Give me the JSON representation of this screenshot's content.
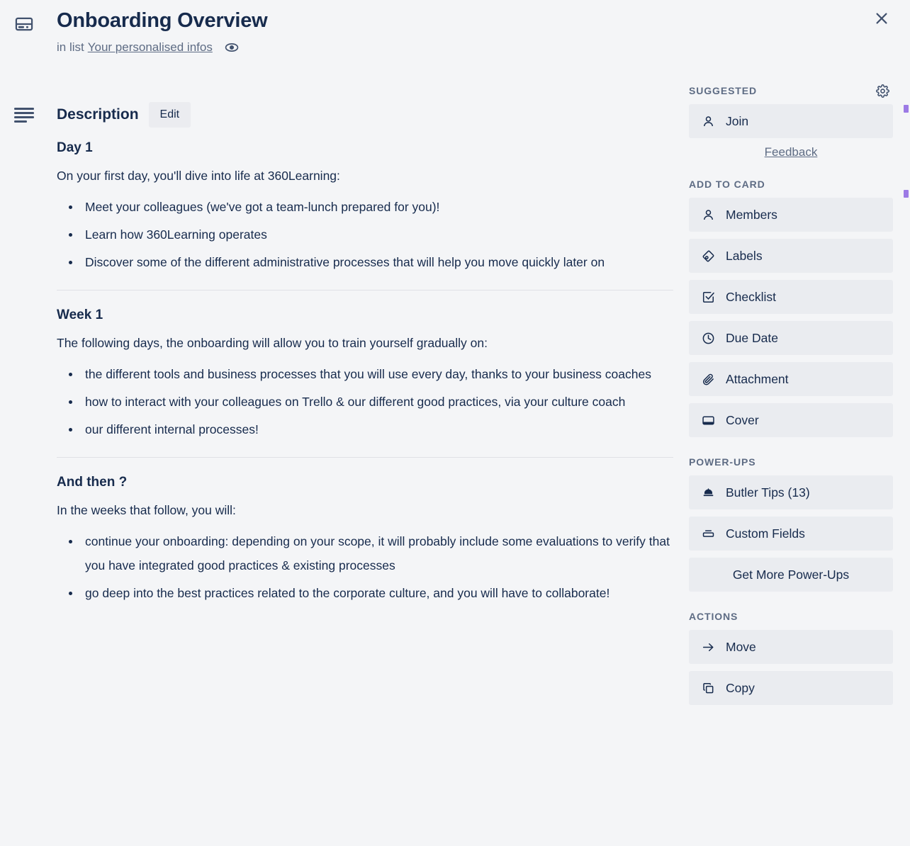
{
  "header": {
    "icon": "card-template-icon",
    "title": "Onboarding Overview",
    "in_list_prefix": "in list",
    "list_name": "Your personalised infos",
    "watch_icon": "eye-icon",
    "close_label": "✕"
  },
  "description": {
    "icon": "description-lines-icon",
    "heading": "Description",
    "edit_label": "Edit",
    "sections": [
      {
        "title": "Day 1",
        "intro": "On your first day, you'll dive into life at 360Learning:",
        "items": [
          "Meet your colleagues (we've got a team-lunch prepared for you)!",
          "Learn how 360Learning operates",
          "Discover some of the different administrative processes that will help you move quickly later on"
        ]
      },
      {
        "title": "Week 1",
        "intro": "The following days, the onboarding will allow you to train yourself gradually on:",
        "items": [
          "the different tools and business processes that you will use every day, thanks to your business coaches",
          "how to interact with your colleagues on Trello & our different good practices, via your culture coach",
          "our different internal processes!"
        ]
      },
      {
        "title": "And then ?",
        "intro": "In the weeks that follow, you will:",
        "items": [
          "continue your onboarding: depending on your scope, it will probably include some evaluations to verify that you have integrated good practices & existing processes",
          "go deep into the best practices related to the corporate culture, and you will have to collaborate!"
        ]
      }
    ]
  },
  "sidebar": {
    "suggested": {
      "heading": "SUGGESTED",
      "gear_icon": "gear-icon",
      "items": [
        {
          "label": "Join",
          "icon": "person-icon"
        }
      ],
      "feedback_label": "Feedback"
    },
    "add_to_card": {
      "heading": "ADD TO CARD",
      "items": [
        {
          "label": "Members",
          "icon": "person-icon"
        },
        {
          "label": "Labels",
          "icon": "tag-icon"
        },
        {
          "label": "Checklist",
          "icon": "checkbox-icon"
        },
        {
          "label": "Due Date",
          "icon": "clock-icon"
        },
        {
          "label": "Attachment",
          "icon": "paperclip-icon"
        },
        {
          "label": "Cover",
          "icon": "cover-card-icon"
        }
      ]
    },
    "power_ups": {
      "heading": "POWER-UPS",
      "items": [
        {
          "label": "Butler Tips (13)",
          "icon": "butler-hat-icon"
        },
        {
          "label": "Custom Fields",
          "icon": "custom-fields-icon"
        }
      ],
      "get_more_label": "Get More Power-Ups"
    },
    "actions": {
      "heading": "ACTIONS",
      "items": [
        {
          "label": "Move",
          "icon": "arrow-right-icon"
        },
        {
          "label": "Copy",
          "icon": "copy-icon"
        }
      ]
    }
  },
  "colors": {
    "page_background": "#f4f5f7",
    "button_background": "#eaecf0",
    "text_primary": "#172b4d",
    "text_muted": "#5e6c84",
    "marker_purple": "#8c64e2"
  }
}
